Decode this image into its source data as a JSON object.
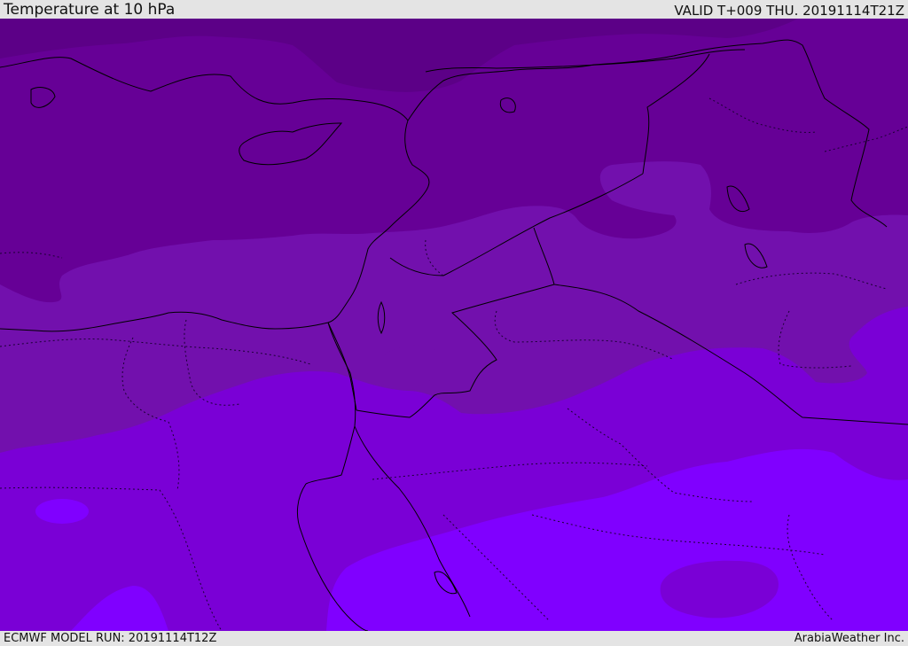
{
  "header": {
    "title": "Temperature at 10 hPa",
    "valid": "VALID T+009 THU. 20191114T21Z"
  },
  "footer": {
    "model_run": "ECMWF MODEL RUN: 20191114T12Z",
    "credit": "ArabiaWeather Inc."
  },
  "map": {
    "variable": "temperature",
    "level": "10 hPa",
    "colors": {
      "band_coldest": "#5c0087",
      "band_cold": "#660096",
      "band_mid": "#7210ad",
      "band_warm": "#7a00d6",
      "band_warmer": "#8000ff",
      "coastline": "#000000",
      "borders": "#1a0033"
    }
  }
}
